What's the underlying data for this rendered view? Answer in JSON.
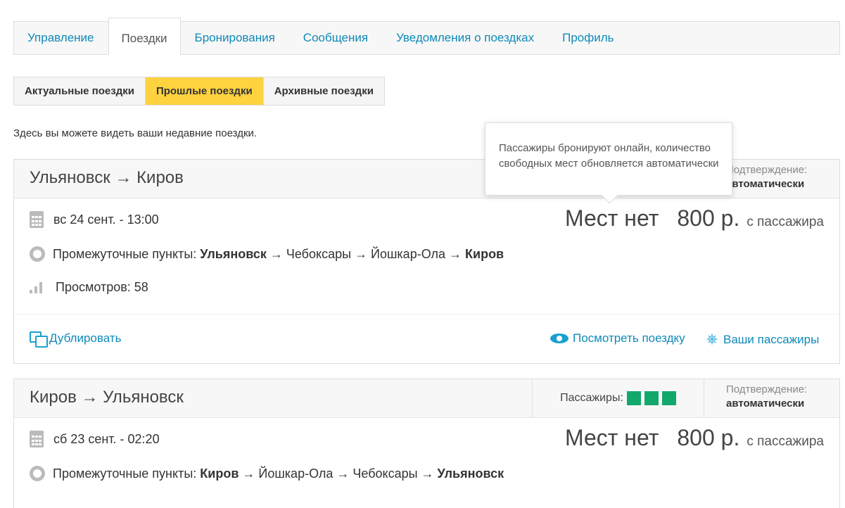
{
  "main_tabs": [
    {
      "label": "Управление"
    },
    {
      "label": "Поездки"
    },
    {
      "label": "Бронирования"
    },
    {
      "label": "Сообщения"
    },
    {
      "label": "Уведомления о поездках"
    },
    {
      "label": "Профиль"
    }
  ],
  "active_main_tab": "Поездки",
  "sub_tabs": [
    {
      "label": "Актуальные поездки"
    },
    {
      "label": "Прошлые поездки"
    },
    {
      "label": "Архивные поездки"
    }
  ],
  "active_sub_tab": "Прошлые поездки",
  "intro_text": "Здесь вы можете видеть ваши недавние поездки.",
  "tooltip": {
    "text": "Пассажиры бронируют онлайн, количество свободных мест обновляется автоматически"
  },
  "trips": [
    {
      "route": "Ульяновск → Киров",
      "confirmation_label": "Подтверждение:",
      "confirmation_value": "автоматически",
      "datetime": "вс 24 сент. - 13:00",
      "stops_label": "Промежуточные пункты:",
      "stops_start": "Ульяновск",
      "stops_middle": " → Чебоксары → Йошкар-Ола → ",
      "stops_end": "Киров",
      "views_label": "Просмотров: 58",
      "seats": "Мест нет",
      "price": "800 р.",
      "price_per": "с пассажира",
      "action_duplicate": "Дублировать",
      "action_view": "Посмотреть поездку",
      "action_passengers": "Ваши пассажиры"
    },
    {
      "route": "Киров → Ульяновск",
      "passengers_label": "Пассажиры:",
      "passengers_count": 3,
      "confirmation_label": "Подтверждение:",
      "confirmation_value": "автоматически",
      "datetime": "сб 23 сент. - 02:20",
      "stops_label": "Промежуточные пункты:",
      "stops_start": "Киров",
      "stops_middle": " → Йошкар-Ола → Чебоксары → ",
      "stops_end": "Ульяновск",
      "seats": "Мест нет",
      "price": "800 р.",
      "price_per": "с пассажира"
    }
  ],
  "colors": {
    "link": "#0f8ab8",
    "active_sub_tab": "#ffd23f",
    "passenger_square": "#13a86b"
  }
}
